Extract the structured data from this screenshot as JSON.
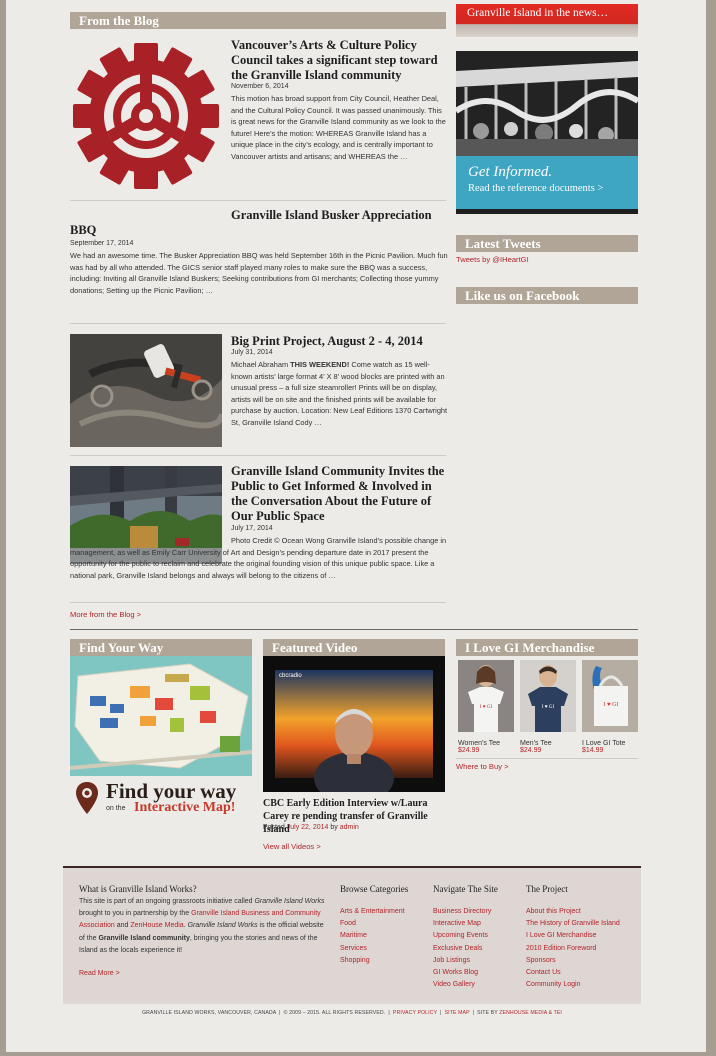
{
  "blog": {
    "heading": "From the Blog",
    "posts": [
      {
        "title": "Vancouver’s Arts & Culture Policy Council takes a significant step toward the Granville Island community",
        "date": "November 6, 2014",
        "excerpt": "This motion has broad support from City Council, Heather Deal, and the Cultural Policy Council. It was passed unanimously. This is great news for the Granville Island community as we look to the future! Here’s the motion: WHEREAS Granville Island has a unique place in the city’s ecology, and is centrally important to Vancouver artists and artisans; and WHEREAS  the …"
      },
      {
        "title": "Granville Island Busker Appreciation BBQ",
        "date": "September 17, 2014",
        "excerpt": " We had an awesome time. The Busker Appreciation BBQ was held September 16th in the Picnic Pavilion. Much fun was had by all who attended.  The GICS senior staff played many roles to make sure the BBQ was a success, including: Inviting all Granville Island Buskers; Seeking contributions from GI merchants; Collecting those yummy donations; Setting up the Picnic Pavilion; …"
      },
      {
        "title": "Big Print Project, August 2 - 4, 2014",
        "date": "July 31, 2014",
        "excerpt_lead": "Michael Abraham ",
        "excerpt_bold": "THIS WEEKEND!",
        "excerpt_rest": " Come watch as 15 well-known artists’ large format 4’ X 8’ wood blocks are printed with an unusual press – a full size steamroller! Prints will be on display, artists will be on site and the finished prints will be available for purchase by auction.   Location: New Leaf Editions 1370 Cartwright St, Granville Island   Cody …"
      },
      {
        "title": "Granville Island Community Invites the Public to Get Informed & Involved in the Conversation About the Future of Our Public Space",
        "date": "July 17, 2014",
        "excerpt": "Photo Credit © Ocean Wong Granville Island’s possible change in management, as well as Emily Carr University of Art and Design’s pending departure date in 2017 present the opportunity for the public to reclaim and celebrate the original founding vision of this unique public space. Like a national park, Granville Island belongs and always will belong to the citizens of …"
      }
    ],
    "more_link": "More from the Blog >"
  },
  "sidebar": {
    "news_banner": "Granville Island in the news…",
    "get_informed_title": "Get Informed.",
    "get_informed_sub": "Read the reference documents >",
    "latest_tweets_heading": "Latest Tweets",
    "tweets_link": "Tweets by @IHeartGI",
    "facebook_heading": "Like us on Facebook"
  },
  "find_way": {
    "heading": "Find Your Way",
    "big_text": "Find your way",
    "small_on": "on the",
    "map_text": "Interactive Map!"
  },
  "featured_video": {
    "heading": "Featured Video",
    "logo": "cbcradio",
    "title": "CBC Early Edition Interview w/Laura Carey re pending transfer of Granville Island",
    "posted_label": "Posted",
    "posted_date": "July 22, 2014",
    "by_label": "by",
    "author": "admin",
    "view_all": "View all Videos >"
  },
  "merch": {
    "heading": "I Love GI Merchandise",
    "items": [
      {
        "name": "Women’s Tee",
        "price": "$24.99"
      },
      {
        "name": "Men’s Tee",
        "price": "$24.99"
      },
      {
        "name": "I Love GI Tote",
        "price": "$14.99"
      }
    ],
    "where_link": "Where to Buy >"
  },
  "footer": {
    "about_title": "What is Granville Island Works?",
    "about_text_1": "This site is part of an ongoing grassroots initiative called ",
    "about_em_1": "Granville Island Works",
    "about_text_2": " brought to you in partnership by the ",
    "about_link_1": "Granville Island Business and Community Association",
    "about_text_3": " and ",
    "about_link_2": "ZenHouse Media",
    "about_text_4": ". ",
    "about_em_2": "Granville Island Works",
    "about_text_5": " is the official website of the ",
    "about_bold": "Granville Island community",
    "about_text_6": ", bringing you the stories and news of the Island as the locals experience it!",
    "read_more": "Read More >",
    "browse_title": "Browse Categories",
    "browse_items": [
      "Arts & Entertainment",
      "Food",
      "Maritime",
      "Services",
      "Shopping"
    ],
    "navigate_title": "Navigate The Site",
    "navigate_items": [
      "Business Directory",
      "Interactive Map",
      "Upcoming Events",
      "Exclusive Deals",
      "Job Listings",
      "GI Works Blog",
      "Video Gallery"
    ],
    "project_title": "The Project",
    "project_items": [
      "About this Project",
      "The History of Granville Island",
      "I Love GI Merchandise",
      "2010 Edition Foreword",
      "Sponsors",
      "Contact Us",
      "Community Login"
    ],
    "bottom_left": "GRANVILLE ISLAND WORKS, VANCOUVER, CANADA",
    "bottom_copy": "© 2009 – 2015. ALL RIGHTS RESERVED.",
    "privacy": "PRIVACY POLICY",
    "sitemap": "SITE MAP",
    "site_by": "SITE BY",
    "site_by_link": "ZENHOUSE MEDIA & TEI"
  },
  "colors": {
    "bar": "#b0a596",
    "accent_red": "#b3252a",
    "teal": "#3ea5c2",
    "footer_bg": "#ddd6d3"
  }
}
